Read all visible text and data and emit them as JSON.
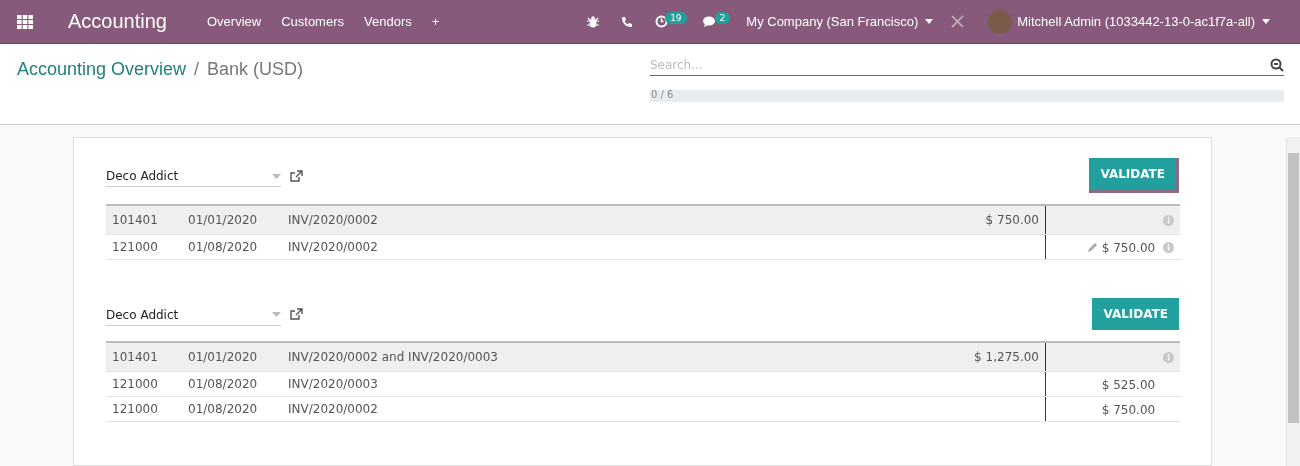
{
  "navbar": {
    "app_title": "Accounting",
    "menu": [
      "Overview",
      "Customers",
      "Vendors",
      "+"
    ],
    "activity_count": "19",
    "message_count": "2",
    "company": "My Company (San Francisco)",
    "user": "Mitchell Admin (1033442-13-0-ac1f7a-all)"
  },
  "breadcrumb": [
    {
      "label": "Accounting Overview",
      "kind": "link"
    },
    {
      "label": "/",
      "kind": "separator"
    },
    {
      "label": "Bank (USD)",
      "kind": "current"
    }
  ],
  "search": {
    "placeholder": "Search..."
  },
  "progress": {
    "text": "0 / 6",
    "level": 0
  },
  "reconciliations": [
    {
      "partner": "Deco Addict",
      "button": "VALIDATE",
      "button_focused": true,
      "rows": [
        {
          "kind": "statement",
          "account": "101401",
          "date": "01/01/2020",
          "label": "INV/2020/0002",
          "debit": "$ 750.00",
          "credit": "",
          "info": true,
          "editable": false
        },
        {
          "kind": "move",
          "account": "121000",
          "date": "01/08/2020",
          "label": "INV/2020/0002",
          "debit": "",
          "credit": "$ 750.00",
          "info": true,
          "editable": true
        }
      ]
    },
    {
      "partner": "Deco Addict",
      "button": "VALIDATE",
      "button_focused": false,
      "rows": [
        {
          "kind": "statement",
          "account": "101401",
          "date": "01/01/2020",
          "label": "INV/2020/0002 and INV/2020/0003",
          "debit": "$ 1,275.00",
          "credit": "",
          "info": true,
          "editable": false
        },
        {
          "kind": "move",
          "account": "121000",
          "date": "01/08/2020",
          "label": "INV/2020/0003",
          "debit": "",
          "credit": "$ 525.00",
          "info": false,
          "editable": false
        },
        {
          "kind": "move",
          "account": "121000",
          "date": "01/08/2020",
          "label": "INV/2020/0002",
          "debit": "",
          "credit": "$ 750.00",
          "info": false,
          "editable": false
        }
      ]
    }
  ]
}
